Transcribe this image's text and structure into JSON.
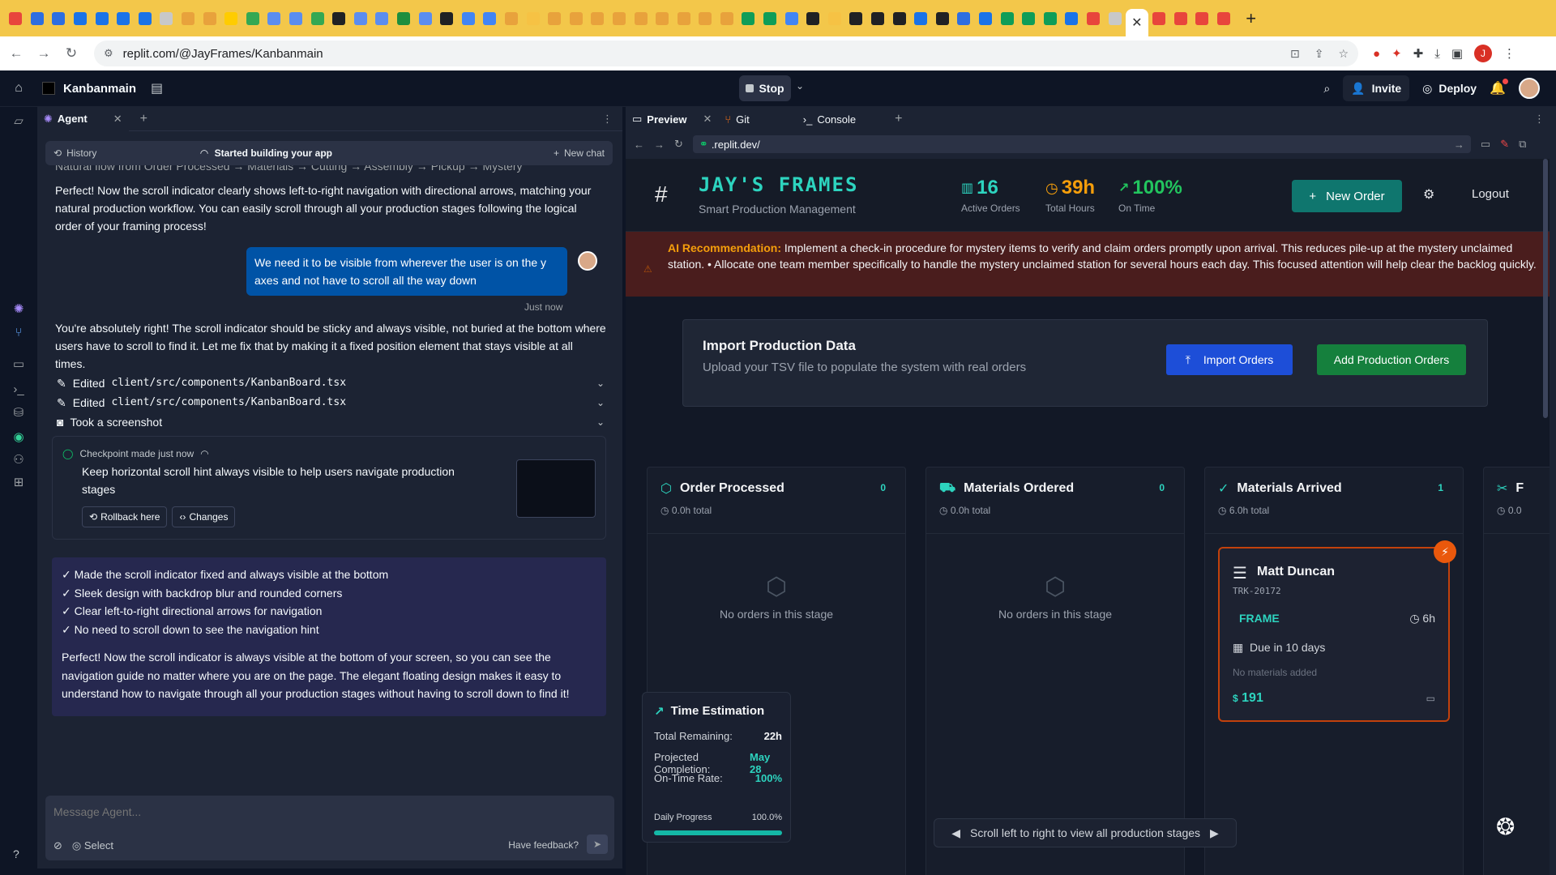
{
  "browser": {
    "url": "replit.com/@JayFrames/Kanbanmain",
    "tab_favicon_colors": [
      "#e8453c",
      "#2e6ee0",
      "#2e6ee0",
      "#1a73e8",
      "#1a73e8",
      "#1a73e8",
      "#1a73e8",
      "#c8c8c8",
      "#e8a23c",
      "#e8a23c",
      "#ffcc00",
      "#34a853",
      "#5b8def",
      "#5b8def",
      "#34a853",
      "#202124",
      "#5b8def",
      "#5b8def",
      "#1e8e3e",
      "#5b8def",
      "#202124",
      "#4285f4",
      "#4285f4",
      "#e8a23c",
      "#f6c244",
      "#e8a23c",
      "#e8a23c",
      "#e8a23c",
      "#e8a23c",
      "#e8a23c",
      "#e8a23c",
      "#e8a23c",
      "#e8a23c",
      "#e8a23c",
      "#0f9d58",
      "#0f9d58",
      "#4285f4",
      "#202124",
      "#f6c244",
      "#202124",
      "#202124",
      "#202124",
      "#1a73e8",
      "#202124",
      "#2e6ee0",
      "#1a73e8",
      "#0f9d58",
      "#0f9d58",
      "#0f9d58",
      "#1a73e8",
      "#e8453c",
      "#c8c8c8",
      "#e8453c",
      "#e8453c",
      "#e8453c",
      "#e8453c"
    ],
    "active_tab_close": "✕",
    "new_tab": "+"
  },
  "topbar": {
    "project_name": "Kanbanmain",
    "stop_label": "Stop",
    "invite_label": "Invite",
    "deploy_label": "Deploy"
  },
  "agent": {
    "tab_label": "Agent",
    "history_label": "History",
    "status_label": "Started building your app",
    "new_chat_label": "New chat",
    "cut_line": "Natural flow from Order Processed → Materials → Cutting → Assembly → Pickup → Mystery",
    "msg1": "Perfect! Now the scroll indicator clearly shows left-to-right navigation with directional arrows, matching your natural production workflow. You can easily scroll through all your production stages following the logical order of your framing process!",
    "user_msg": "We need it to be visible from wherever the user is on the y axes and not have to scroll all the way down",
    "user_time": "Just now",
    "msg2": "You're absolutely right! The scroll indicator should be sticky and always visible, not buried at the bottom where users have to scroll to find it. Let me fix that by making it a fixed position element that stays visible at all times.",
    "actions": [
      {
        "prefix": "Edited",
        "file": "client/src/components/KanbanBoard.tsx"
      },
      {
        "prefix": "Edited",
        "file": "client/src/components/KanbanBoard.tsx"
      },
      {
        "prefix": "Took a screenshot",
        "file": ""
      }
    ],
    "checkpoint": {
      "head": "Checkpoint made just now",
      "title": "Keep horizontal scroll hint always visible to help users navigate production stages",
      "rollback_label": "Rollback here",
      "changes_label": "Changes"
    },
    "summary_items": [
      "✓ Made the scroll indicator fixed and always visible at the bottom",
      "✓ Sleek design with backdrop blur and rounded corners",
      "✓ Clear left-to-right directional arrows for navigation",
      "✓ No need to scroll down to see the navigation hint"
    ],
    "summary_text": "Perfect! Now the scroll indicator is always visible at the bottom of your screen, so you can see the navigation guide no matter where you are on the page. The elegant floating design makes it easy to understand how to navigate through all your production stages without having to scroll down to find it!",
    "composer_placeholder": "Message Agent...",
    "select_label": "Select",
    "feedback_label": "Have feedback?"
  },
  "preview": {
    "tabs": [
      "Preview",
      "Git",
      "Console"
    ],
    "url": ".replit.dev/"
  },
  "app": {
    "brand": "JAY'S FRAMES",
    "subtitle": "Smart Production Management",
    "stats": [
      {
        "value": "16",
        "label": "Active Orders"
      },
      {
        "value": "39h",
        "label": "Total Hours"
      },
      {
        "value": "100%",
        "label": "On Time"
      }
    ],
    "new_order_label": "New Order",
    "logout_label": "Logout",
    "ai_label": "AI Recommendation:",
    "ai_text": "Implement a check-in procedure for mystery items to verify and claim orders promptly upon arrival. This reduces pile-up at the mystery unclaimed station.  •  Allocate one team member specifically to handle the mystery unclaimed station for several hours each day. This focused attention will help clear the backlog quickly.",
    "import": {
      "title": "Import Production Data",
      "subtitle": "Upload your TSV file to populate the system with real orders",
      "import_label": "Import Orders",
      "add_label": "Add Production Orders"
    },
    "columns": [
      {
        "title": "Order Processed",
        "count": "0",
        "total": "0.0h total",
        "empty": "No orders in this stage"
      },
      {
        "title": "Materials Ordered",
        "count": "0",
        "total": "0.0h total",
        "empty": "No orders in this stage"
      },
      {
        "title": "Materials Arrived",
        "count": "1",
        "total": "6.0h total",
        "empty": ""
      },
      {
        "title": "F",
        "count": "",
        "total": "0.0",
        "empty": ""
      }
    ],
    "order": {
      "name": "Matt Duncan",
      "tracking": "TRK-20172",
      "type": "FRAME",
      "hours": "6h",
      "due": "Due in 10 days",
      "materials": "No materials added",
      "price": "191"
    },
    "time_estimation": {
      "title": "Time Estimation",
      "rows": [
        {
          "label": "Total Remaining:",
          "value": "22h"
        },
        {
          "label": "Projected Completion:",
          "value": "May 28"
        },
        {
          "label": "On-Time Rate:",
          "value": "100%"
        },
        {
          "label": "Daily Progress",
          "value": "100.0%"
        }
      ],
      "progress": 1.0
    },
    "scroll_hint": "Scroll left to right to view all production stages"
  }
}
